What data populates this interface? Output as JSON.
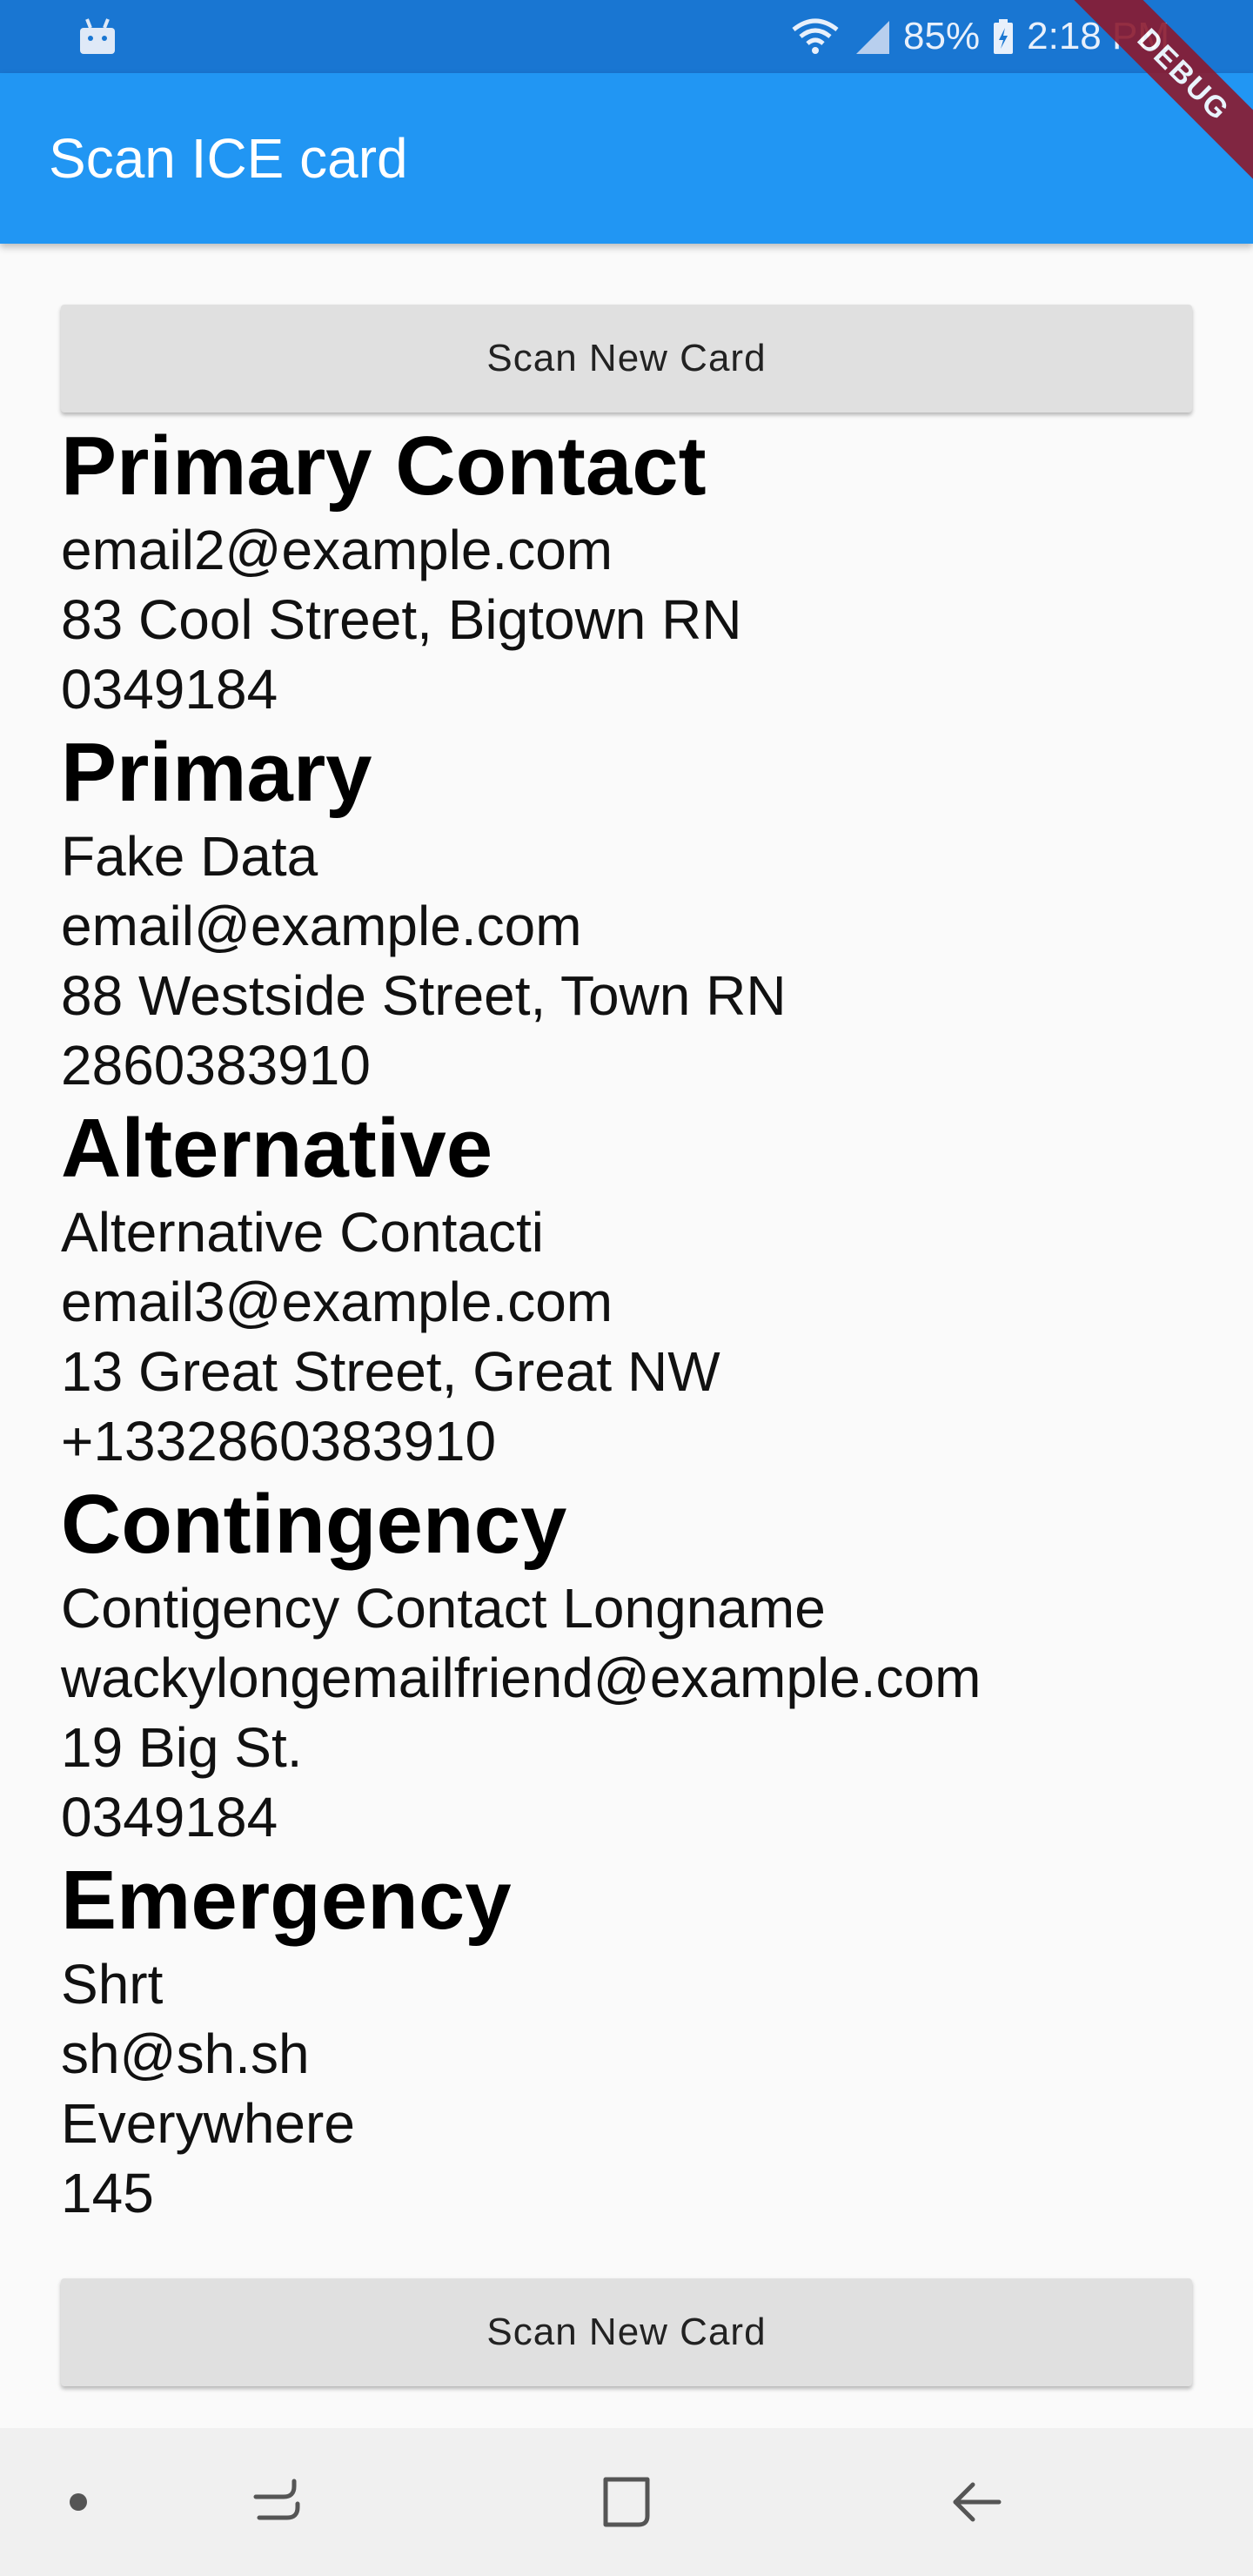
{
  "status_bar": {
    "battery": "85%",
    "time": "2:18 PM",
    "icons": [
      "android-icon",
      "wifi-icon",
      "signal-icon",
      "battery-icon"
    ]
  },
  "app_bar": {
    "title": "Scan ICE card"
  },
  "debug_banner": "DEBUG",
  "buttons": {
    "scan_top": "Scan New Card",
    "scan_bottom": "Scan New Card"
  },
  "sections": [
    {
      "title": "Primary Contact",
      "lines": [
        "email2@example.com",
        "83 Cool Street, Bigtown RN",
        "0349184"
      ]
    },
    {
      "title": "Primary",
      "lines": [
        "Fake Data",
        "email@example.com",
        "88 Westside Street, Town RN",
        "2860383910"
      ]
    },
    {
      "title": "Alternative",
      "lines": [
        "Alternative Contacti",
        "email3@example.com",
        "13 Great Street, Great NW",
        "+1332860383910"
      ]
    },
    {
      "title": "Contingency",
      "lines": [
        "Contigency Contact Longname",
        "wackylongemailfriend@example.com",
        "19 Big St.",
        "0349184"
      ]
    },
    {
      "title": "Emergency",
      "lines": [
        "Shrt",
        "sh@sh.sh",
        "Everywhere",
        "145"
      ]
    }
  ],
  "nav_bar": {
    "icons": [
      "dot-icon",
      "recent-apps-icon",
      "home-icon",
      "back-icon"
    ]
  },
  "colors": {
    "status_bar": "#1976d2",
    "app_bar": "#2196f3",
    "button": "#e0e0e0",
    "background": "#fafafa",
    "debug": "#8b1a2e"
  }
}
